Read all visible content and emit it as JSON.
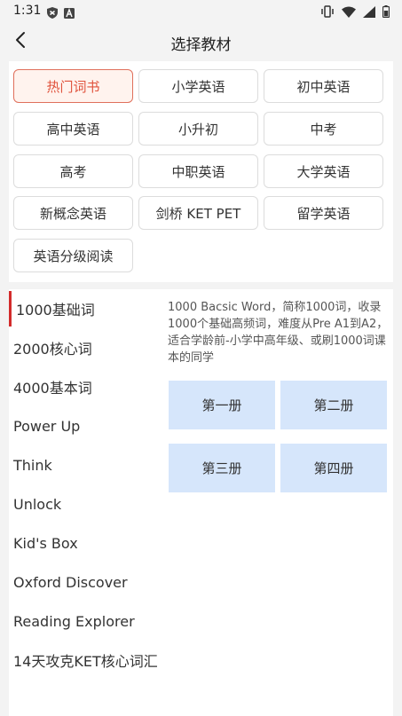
{
  "status": {
    "time": "1:31",
    "left_icons": [
      "shield-icon",
      "a-box-icon"
    ],
    "right_icons": [
      "vibrate-icon",
      "wifi-icon",
      "signal-icon",
      "battery-icon"
    ]
  },
  "nav": {
    "title": "选择教材",
    "back_icon": "chevron-left-icon"
  },
  "categories": [
    {
      "label": "热门词书",
      "active": true
    },
    {
      "label": "小学英语"
    },
    {
      "label": "初中英语"
    },
    {
      "label": "高中英语"
    },
    {
      "label": "小升初"
    },
    {
      "label": "中考"
    },
    {
      "label": "高考"
    },
    {
      "label": "中职英语"
    },
    {
      "label": "大学英语"
    },
    {
      "label": "新概念英语"
    },
    {
      "label": "剑桥 KET PET"
    },
    {
      "label": "留学英语"
    },
    {
      "label": "英语分级阅读"
    }
  ],
  "sidebar": [
    {
      "label": "1000基础词",
      "active": true
    },
    {
      "label": "2000核心词"
    },
    {
      "label": "4000基本词"
    },
    {
      "label": "Power Up"
    },
    {
      "label": "Think"
    },
    {
      "label": "Unlock"
    },
    {
      "label": "Kid's Box"
    },
    {
      "label": "Oxford Discover"
    },
    {
      "label": "Reading Explorer"
    },
    {
      "label": "14天攻克KET核心词汇"
    }
  ],
  "detail": {
    "description": "1000 Bacsic Word，简称1000词，收录1000个基础高频词，难度从Pre A1到A2，适合学龄前-小学中高年级、或刷1000词课本的同学",
    "volumes": [
      "第一册",
      "第二册",
      "第三册",
      "第四册"
    ]
  },
  "colors": {
    "accent_red": "#e0533d",
    "active_bar": "#d32b2b",
    "volume_bg": "#d6e6fb"
  }
}
